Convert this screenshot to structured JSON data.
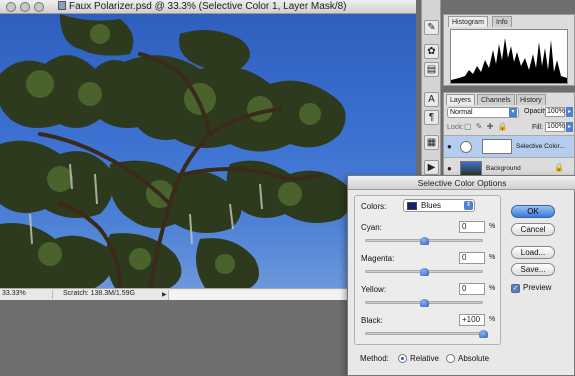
{
  "document": {
    "title": "Faux Polarizer.psd @ 33.3% (Selective Color 1, Layer Mask/8)",
    "zoom": "33.33%",
    "scratch": "Scratch: 138.3M/1.59G"
  },
  "panels": {
    "histogram_tabs": [
      "Histogram",
      "Info"
    ],
    "layers_tabs": [
      "Layers",
      "Channels",
      "History"
    ],
    "blend_mode": "Normal",
    "opacity_label": "Opacity:",
    "opacity_value": "100%",
    "lock_label": "Lock:",
    "fill_label": "Fill:",
    "fill_value": "100%",
    "layers": [
      {
        "name": "Selective Color...",
        "selected": true
      },
      {
        "name": "Background",
        "selected": false
      }
    ]
  },
  "dialog": {
    "title": "Selective Color Options",
    "colors_label": "Colors:",
    "colors_value": "Blues",
    "sliders": [
      {
        "label": "Cyan:",
        "value": "0",
        "unit": "%",
        "position": 0.5
      },
      {
        "label": "Magenta:",
        "value": "0",
        "unit": "%",
        "position": 0.5
      },
      {
        "label": "Yellow:",
        "value": "0",
        "unit": "%",
        "position": 0.5
      },
      {
        "label": "Black:",
        "value": "+100",
        "unit": "%",
        "position": 1.0
      }
    ],
    "method_label": "Method:",
    "method_options": [
      "Relative",
      "Absolute"
    ],
    "method_selected": "Relative",
    "buttons": {
      "ok": "OK",
      "cancel": "Cancel",
      "load": "Load...",
      "save": "Save..."
    },
    "preview_label": "Preview",
    "preview_checked": true
  },
  "colors": {
    "accent": "#3c78d8",
    "selection": "#b4cdee",
    "sky": "#3a6fd0"
  }
}
